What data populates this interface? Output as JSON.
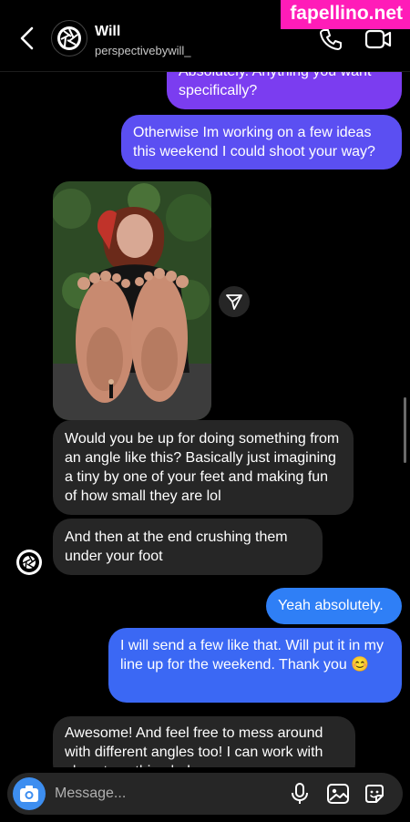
{
  "header": {
    "name": "Will",
    "username": "perspectivebywill_"
  },
  "watermark": "fapellino.net",
  "messages": [
    {
      "text": "Absolutely. Anything you want specifically?"
    },
    {
      "text": "Otherwise Im working on a few ideas this weekend I could shoot your way?"
    },
    {
      "text": "Would you be up for doing something from an angle like this? Basically just imagining a tiny by one of your feet and making fun of how small they are lol"
    },
    {
      "text": "And then at the end crushing them under your foot"
    },
    {
      "text": "Yeah absolutely."
    },
    {
      "text": "I will send a few like that. Will put it in my line up for the weekend. Thank you 😊"
    },
    {
      "text": "Awesome! And feel free to mess around with different angles too! I can work with almost anything haha"
    }
  ],
  "composer": {
    "placeholder": "Message..."
  },
  "colors": {
    "purple": "#7b3df0",
    "blue": "#3b68f4",
    "incoming": "#262626",
    "camera": "#3d8ef0",
    "watermark_bg": "#ff1cb8"
  }
}
